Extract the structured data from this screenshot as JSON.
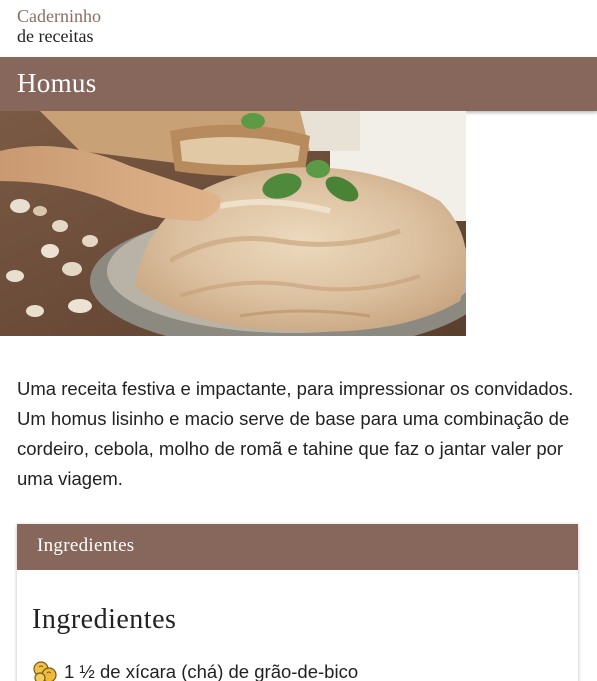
{
  "brand": {
    "line1": "Caderninho",
    "line2": "de receitas"
  },
  "recipe": {
    "title": "Homus",
    "intro": "Uma receita festiva e impactante, para impressionar os convidados. Um homus lisinho e macio serve de base para uma combinação de cordeiro, cebola, molho de romã e tahine que faz o jantar valer por uma viagem."
  },
  "ingredients_card": {
    "header": "Ingredientes",
    "heading": "Ingredientes",
    "items": [
      {
        "icon": "chickpea-icon",
        "text": "1 ½ de xícara (chá) de grão-de-bico"
      }
    ]
  },
  "colors": {
    "accent": "#87675b",
    "brand_text": "#8a6e63",
    "text": "#222222"
  }
}
